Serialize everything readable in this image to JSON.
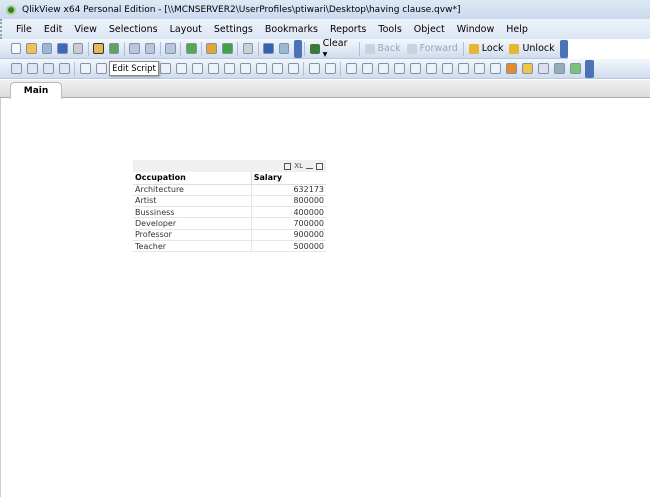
{
  "window": {
    "title": "QlikView x64 Personal Edition - [\\\\MCNSERVER2\\UserProfiles\\ptiwari\\Desktop\\having clause.qvw*]"
  },
  "menu": [
    "File",
    "Edit",
    "View",
    "Selections",
    "Layout",
    "Settings",
    "Bookmarks",
    "Reports",
    "Tools",
    "Object",
    "Window",
    "Help"
  ],
  "toolbar1": {
    "icons": [
      "new-icon",
      "open-icon",
      "reload-icon",
      "save-icon",
      "print-icon",
      "edit-script-icon",
      "reload-data-icon",
      "undo-icon",
      "redo-icon",
      "search-icon",
      "check-icon",
      "chart-icon",
      "favorite-icon",
      "edit-icon",
      "help-icon",
      "whats-this-icon"
    ],
    "clear": "Clear ▾",
    "back": "Back",
    "forward": "Forward",
    "lock": "Lock",
    "unlock": "Unlock"
  },
  "toolbar2": {
    "icons": [
      "new-sheet-icon",
      "move-left-icon",
      "move-right-icon",
      "sheet-props-icon",
      "listbox-icon",
      "statistics-icon",
      "multibox-icon",
      "table-icon",
      "input-icon",
      "button-icon",
      "text-icon",
      "line-icon",
      "slider-icon",
      "bookmark-icon",
      "search-object-icon",
      "container-icon",
      "calendar-icon",
      "chart-wizard-icon",
      "align-icon",
      "design-icon",
      "align-left-icon",
      "align-center-icon",
      "align-right-icon",
      "align-top-icon",
      "align-middle-icon",
      "align-bottom-icon",
      "space-h-icon",
      "space-v-icon",
      "grid-icon",
      "snap-icon",
      "color-icon",
      "layer-icon",
      "properties-icon",
      "server-icon",
      "document-icon"
    ]
  },
  "tooltip": "Edit Script",
  "tabs": [
    {
      "label": "Main"
    }
  ],
  "table": {
    "caption_icons": [
      "print-icon",
      "excel-icon",
      "minimize-icon",
      "maximize-icon"
    ],
    "excel_label": "XL",
    "columns": [
      "Occupation",
      "Salary"
    ],
    "rows": [
      [
        "Architecture",
        "632173"
      ],
      [
        "Artist",
        "800000"
      ],
      [
        "Bussiness",
        "400000"
      ],
      [
        "Developer",
        "700000"
      ],
      [
        "Professor",
        "900000"
      ],
      [
        "Teacher",
        "500000"
      ]
    ]
  }
}
